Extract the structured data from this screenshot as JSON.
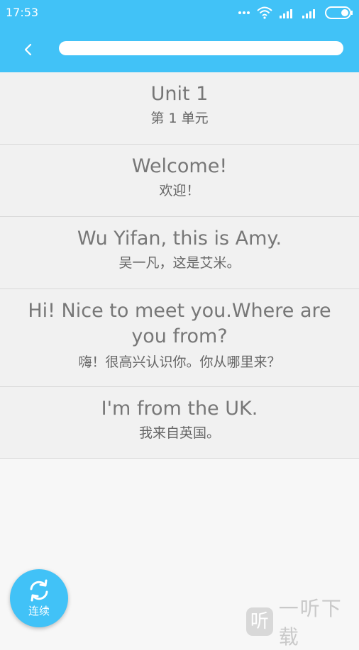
{
  "status_bar": {
    "time": "17:53",
    "icons": [
      "more-dots-icon",
      "wifi-icon",
      "signal-icon",
      "signal-icon",
      "battery-icon"
    ]
  },
  "app_bar": {
    "back_icon": "chevron-left-icon",
    "accent_color": "#41c2f7"
  },
  "lessons": [
    {
      "en": "Unit 1",
      "zh": "第 1 单元"
    },
    {
      "en": "Welcome!",
      "zh": "欢迎！"
    },
    {
      "en": "Wu Yifan, this is Amy.",
      "zh": "吴一凡，这是艾米。"
    },
    {
      "en": "Hi! Nice to meet you.Where are you from?",
      "zh": "嗨！很高兴认识你。你从哪里来？"
    },
    {
      "en": "I'm from the UK.",
      "zh": "我来自英国。"
    }
  ],
  "fab": {
    "label": "连续",
    "icon": "repeat-icon"
  },
  "watermark": {
    "logo_char": "听",
    "text": "一听下载"
  }
}
